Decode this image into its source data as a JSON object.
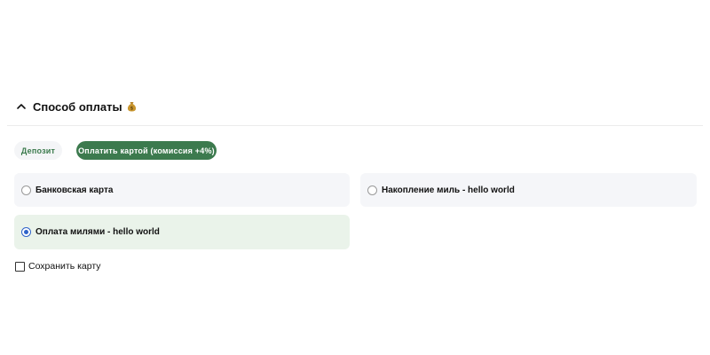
{
  "section": {
    "title": "Способ оплаты",
    "emoji": "💰",
    "icon": "chevron-up-icon"
  },
  "tabs": [
    {
      "label": "Депозит",
      "active": false
    },
    {
      "label": "Оплатить картой (комиссия +4%)",
      "active": true
    }
  ],
  "options": [
    {
      "label": "Банковская карта",
      "selected": false
    },
    {
      "label": "Накопление миль - hello world",
      "selected": false
    },
    {
      "label": "Оплата милями - hello world",
      "selected": true
    }
  ],
  "save_card": {
    "label": "Сохранить карту",
    "checked": false
  },
  "colors": {
    "accent_green": "#3c7a4e",
    "selected_bg": "#eaf3ea",
    "option_bg": "#f5f6f9",
    "radio_blue": "#2f63c9"
  }
}
